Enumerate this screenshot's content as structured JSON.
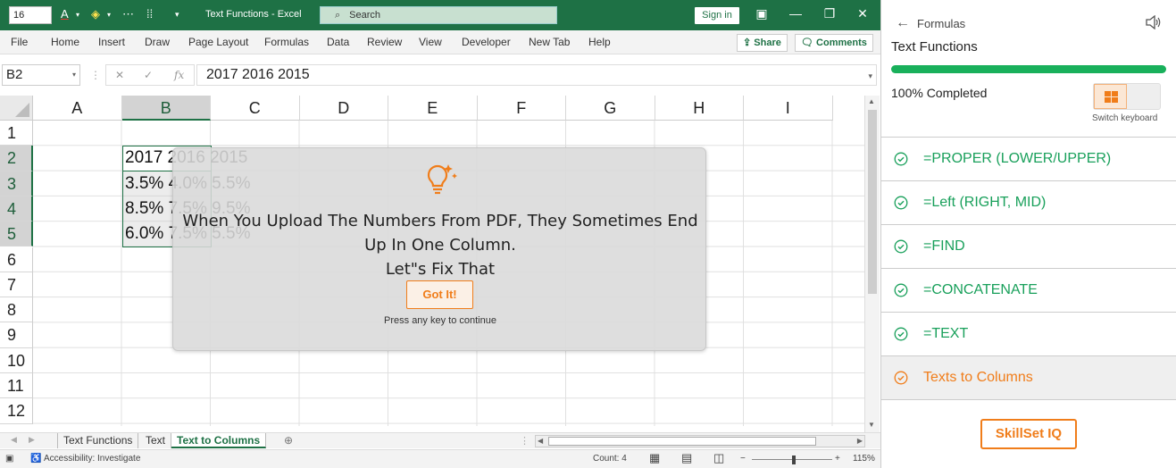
{
  "excel": {
    "font_size": "16",
    "doc_title": "Text Functions  -  Excel",
    "search_placeholder": "Search",
    "sign_in": "Sign in",
    "menu": [
      "File",
      "Home",
      "Insert",
      "Draw",
      "Page Layout",
      "Formulas",
      "Data",
      "Review",
      "View",
      "Developer",
      "New Tab",
      "Help"
    ],
    "share": "Share",
    "comments": "Comments",
    "name_box": "B2",
    "formula": "2017 2016 2015",
    "columns": [
      "A",
      "B",
      "C",
      "D",
      "E",
      "F",
      "G",
      "H",
      "I"
    ],
    "selected_column": "B",
    "rows": [
      "1",
      "2",
      "3",
      "4",
      "5",
      "6",
      "7",
      "8",
      "9",
      "10",
      "11",
      "12"
    ],
    "selected_rows": [
      "2",
      "3",
      "4",
      "5"
    ],
    "cells": [
      {
        "row": "2",
        "text": "2017 2016 2015"
      },
      {
        "row": "3",
        "text": "3.5% 4.0% 5.5%"
      },
      {
        "row": "4",
        "text": "8.5% 7.5% 9.5%"
      },
      {
        "row": "5",
        "text": "6.0% 7.5% 5.5%"
      }
    ],
    "sheet_tabs": [
      "Text Functions",
      "Text",
      "Text to Columns"
    ],
    "active_sheet": "Text to Columns",
    "status": {
      "accessibility": "Accessibility: Investigate",
      "count": "Count: 4",
      "zoom": "115%"
    }
  },
  "dialog": {
    "message_line1": "When You Upload The Numbers From PDF, They Sometimes End",
    "message_line2": "Up In One Column.",
    "message_line3": "Let\"s Fix That",
    "button": "Got It!",
    "hint": "Press any key to continue",
    "accent": "#f07d1a"
  },
  "panel": {
    "breadcrumb": "Formulas",
    "title": "Text Functions",
    "progress": 1.0,
    "completed": "100% Completed",
    "switch_keyboard": "Switch keyboard",
    "lessons": [
      {
        "label": "=PROPER (LOWER/UPPER)",
        "done": true
      },
      {
        "label": "=Left (RIGHT, MID)",
        "done": true
      },
      {
        "label": "=FIND",
        "done": true
      },
      {
        "label": "=CONCATENATE",
        "done": true
      },
      {
        "label": "=TEXT",
        "done": true
      },
      {
        "label": "Texts to Columns",
        "done": true,
        "active": true
      }
    ],
    "skillset_button": "SkillSet IQ",
    "green": "#19b05b"
  }
}
